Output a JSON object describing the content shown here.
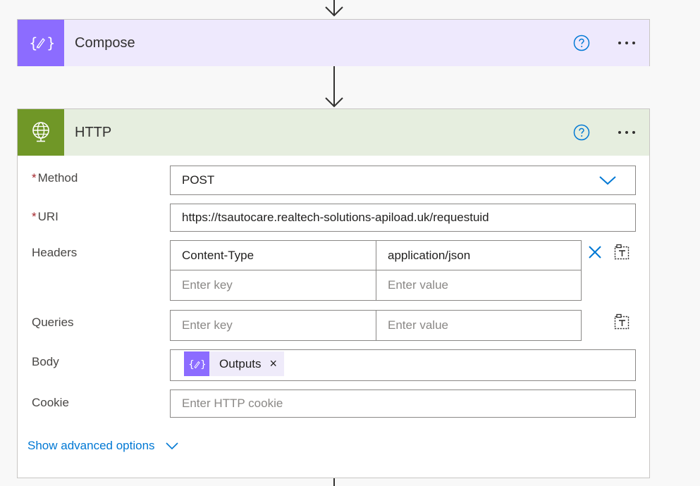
{
  "compose": {
    "title": "Compose",
    "icon": "compose-braces-icon"
  },
  "http": {
    "title": "HTTP",
    "icon": "globe-icon",
    "method": {
      "label": "Method",
      "required": true,
      "value": "POST"
    },
    "uri": {
      "label": "URI",
      "required": true,
      "value": "https://tsautocare.realtech-solutions-apiload.uk/requestuid"
    },
    "headers": {
      "label": "Headers",
      "rows": [
        {
          "key": "Content-Type",
          "value": "application/json"
        }
      ],
      "key_placeholder": "Enter key",
      "value_placeholder": "Enter value"
    },
    "queries": {
      "label": "Queries",
      "key_placeholder": "Enter key",
      "value_placeholder": "Enter value"
    },
    "body": {
      "label": "Body",
      "token_label": "Outputs",
      "token_remove": "×"
    },
    "cookie": {
      "label": "Cookie",
      "placeholder": "Enter HTTP cookie"
    },
    "show_advanced": "Show advanced options"
  },
  "colors": {
    "compose_accent": "#8c6cff",
    "compose_header_bg": "#eee9fd",
    "http_accent": "#709727",
    "http_header_bg": "#e6eedf",
    "link": "#0078d4"
  }
}
